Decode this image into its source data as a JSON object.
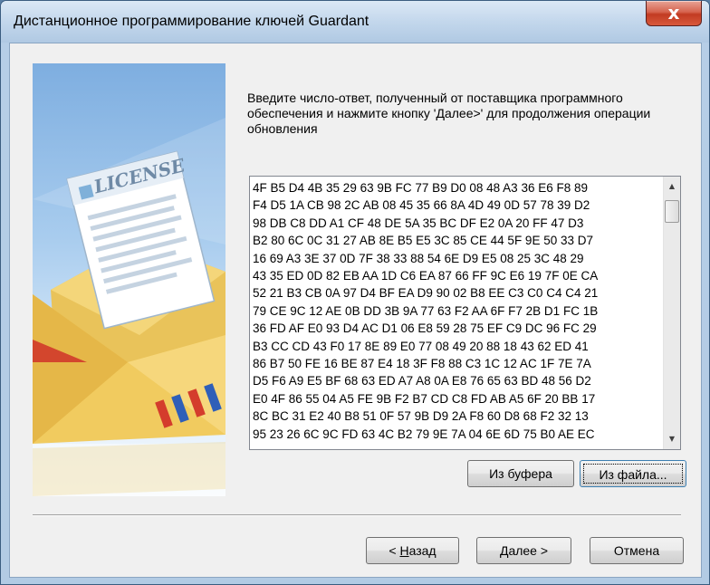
{
  "window": {
    "title": "Дистанционное программирование ключей Guardant",
    "close_glyph": "x"
  },
  "banner": {
    "label": "LICENSE"
  },
  "main": {
    "instruction": "Введите число-ответ, полученный от поставщика программного обеспечения и нажмите кнопку 'Далее>' для продолжения операции обновления",
    "response_lines": [
      "4F B5 D4 4B 35 29 63 9B FC 77 B9 D0 08 48 A3 36 E6 F8 89",
      "F4 D5 1A CB 98 2C AB 08 45 35 66 8A 4D 49 0D 57 78 39 D2",
      "98 DB C8 DD A1 CF 48 DE 5A 35 BC DF E2 0A 20 FF 47 D3",
      "B2 80 6C 0C 31 27 AB 8E B5 E5 3C 85 CE 44 5F 9E 50 33 D7",
      "16 69 A3 3E 37 0D 7F 38 33 88 54 6E D9 E5 08 25 3C 48 29",
      "43 35 ED 0D 82 EB AA 1D C6 EA 87 66 FF 9C E6 19 7F 0E CA",
      "52 21 B3 CB 0A 97 D4 BF EA D9 90 02 B8 EE C3 C0 C4 C4 21",
      "79 CE 9C 12 AE 0B DD 3B 9A 77 63 F2 AA 6F F7 2B D1 FC 1B",
      "36 FD AF E0 93 D4 AC D1 06 E8 59 28 75 EF C9 DC 96 FC 29",
      "B3 CC CD 43 F0 17 8E 89 E0 77 08 49 20 88 18 43 62 ED 41",
      "86 B7 50 FE 16 BE 87 E4 18 3F F8 88 C3 1C 12 AC 1F 7E 7A",
      "D5 F6 A9 E5 BF 68 63 ED A7 A8 0A E8 76 65 63 BD 48 56 D2",
      "E0 4F 86 55 04 A5 FE 9B F2 B7 CD C8 FD AB A5 6F 20 BB 17",
      "8C BC 31 E2 40 B8 51 0F 57 9B D9 2A F8 60 D8 68 F2 32 13",
      "95 23 26 6C 9C FD 63 4C B2 79 9E 7A 04 6E 6D 75 B0 AE EC"
    ],
    "buttons": {
      "from_clipboard": "Из буфера",
      "from_file": "Из файла..."
    }
  },
  "footer": {
    "back": {
      "mnemonic": "Н",
      "rest": "азад",
      "prefix": "< "
    },
    "next": {
      "mnemonic": "Д",
      "rest": "алее >"
    },
    "cancel": "Отмена"
  }
}
